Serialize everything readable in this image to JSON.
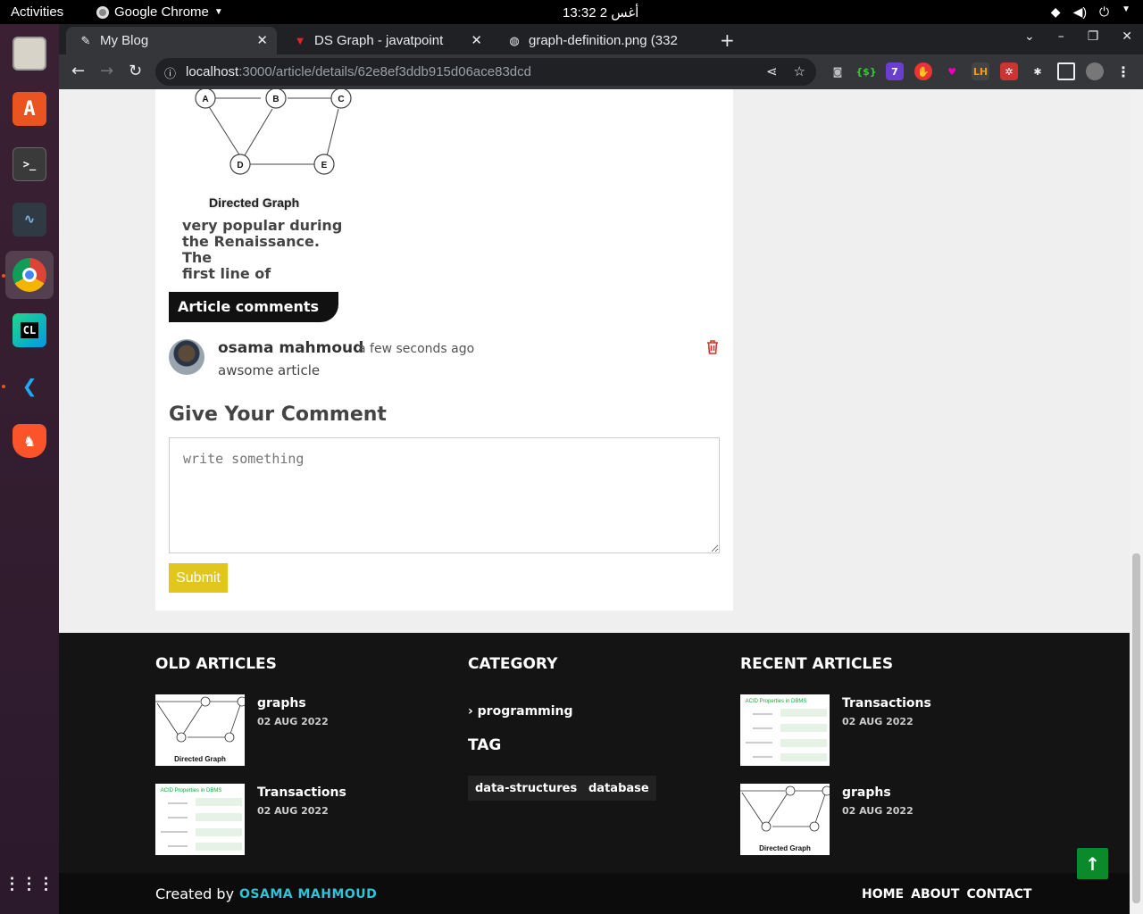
{
  "topbar": {
    "activities": "Activities",
    "app_name": "Google Chrome",
    "clock": "13:32  2 أغس"
  },
  "browser": {
    "tabs": [
      {
        "title": "My Blog"
      },
      {
        "title": "DS Graph - javatpoint"
      },
      {
        "title": "graph-definition.png (332"
      }
    ],
    "url_host": "localhost",
    "url_path": ":3000/article/details/62e8ef3ddb915d06ace83dcd"
  },
  "article": {
    "figure_caption": "Directed Graph",
    "node_labels": [
      "A",
      "B",
      "C",
      "D",
      "E"
    ],
    "text_lines": [
      "very popular during",
      "the Renaissance. The",
      "first line of"
    ]
  },
  "comments": {
    "heading": "Article comments",
    "items": [
      {
        "author": "osama mahmoud",
        "time": "a few seconds ago",
        "text": "awsome article"
      }
    ]
  },
  "comment_form": {
    "title": "Give Your Comment",
    "placeholder": "write something",
    "submit_label": "Submit"
  },
  "footer": {
    "old_articles_title": "OLD ARTICLES",
    "old_articles": [
      {
        "title": "graphs",
        "date": "02 AUG 2022"
      },
      {
        "title": "Transactions",
        "date": "02 AUG 2022"
      }
    ],
    "category_title": "CATEGORY",
    "categories": [
      "programming"
    ],
    "tag_title": "TAG",
    "tags": [
      "data-structures",
      "database"
    ],
    "recent_articles_title": "RECENT ARTICLES",
    "recent_articles": [
      {
        "title": "Transactions",
        "date": "02 AUG 2022"
      },
      {
        "title": "graphs",
        "date": "02 AUG 2022"
      }
    ],
    "thumb_caption": "Directed Graph",
    "thumb_acid": "ACID Properties in DBMS"
  },
  "copyright": {
    "created_by": "Created by",
    "author": "OSAMA MAHMOUD",
    "links": [
      "HOME",
      "ABOUT",
      "CONTACT"
    ]
  },
  "colors": {
    "accent": "#e1c61e",
    "footer_bg": "#141414",
    "author_link": "#2ec4d6",
    "scroll_top": "#0a8a2a"
  }
}
